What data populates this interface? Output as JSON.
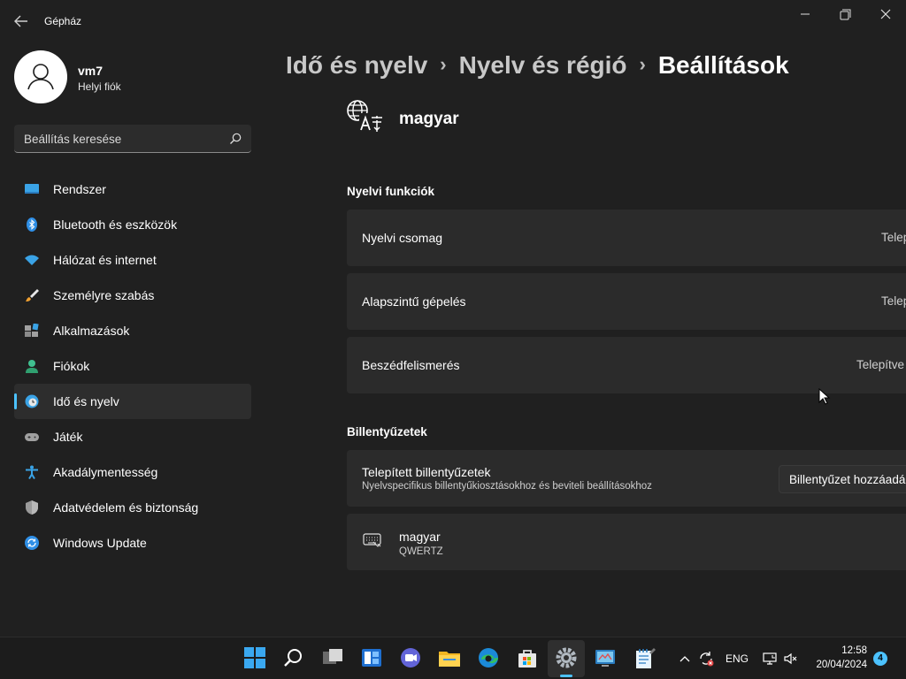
{
  "window": {
    "title": "Gépház",
    "controls": [
      "minimize-icon",
      "maximize-icon",
      "close-icon"
    ]
  },
  "profile": {
    "name": "vm7",
    "account_type": "Helyi fiók"
  },
  "search": {
    "placeholder": "Beállítás keresése"
  },
  "sidebar": {
    "items": [
      {
        "label": "Rendszer",
        "icon": "system-icon"
      },
      {
        "label": "Bluetooth és eszközök",
        "icon": "bluetooth-icon"
      },
      {
        "label": "Hálózat és internet",
        "icon": "wifi-icon"
      },
      {
        "label": "Személyre szabás",
        "icon": "brush-icon"
      },
      {
        "label": "Alkalmazások",
        "icon": "apps-icon"
      },
      {
        "label": "Fiókok",
        "icon": "accounts-icon"
      },
      {
        "label": "Idő és nyelv",
        "icon": "time-language-icon",
        "active": true
      },
      {
        "label": "Játék",
        "icon": "gamepad-icon"
      },
      {
        "label": "Akadálymentesség",
        "icon": "accessibility-icon"
      },
      {
        "label": "Adatvédelem és biztonság",
        "icon": "shield-icon"
      },
      {
        "label": "Windows Update",
        "icon": "update-icon"
      }
    ]
  },
  "breadcrumb": {
    "items": [
      "Idő és nyelv",
      "Nyelv és régió",
      "Beállítások"
    ]
  },
  "language": {
    "name": "magyar",
    "icon": "language-icon"
  },
  "language_features": {
    "title": "Nyelvi funkciók",
    "items": [
      {
        "label": "Nyelvi csomag",
        "status": "Telep"
      },
      {
        "label": "Alapszintű gépelés",
        "status": "Telep"
      },
      {
        "label": "Beszédfelismerés",
        "status": "Telepítve"
      }
    ]
  },
  "keyboards": {
    "title": "Billentyűzetek",
    "installed_label": "Telepített billentyűzetek",
    "installed_desc": "Nyelvspecifikus billentyűkiosztásokhoz és beviteli beállításokhoz",
    "add_button": "Billentyűzet hozzáadá",
    "items": [
      {
        "name": "magyar",
        "layout": "QWERTZ",
        "icon": "keyboard-icon"
      }
    ]
  },
  "taskbar": {
    "apps": [
      "start-icon",
      "search-icon",
      "task-view-icon",
      "widgets-icon",
      "teams-chat-icon",
      "file-explorer-icon",
      "edge-icon",
      "store-icon",
      "settings-icon",
      "control-panel-icon",
      "notepad-icon"
    ],
    "tray": {
      "language": "ENG",
      "time": "12:58",
      "date": "20/04/2024",
      "notifications": "4"
    }
  },
  "colors": {
    "background": "#202020",
    "card": "#2b2b2b",
    "accent": "#4cc2ff",
    "taskbar": "#1c1c1c"
  }
}
